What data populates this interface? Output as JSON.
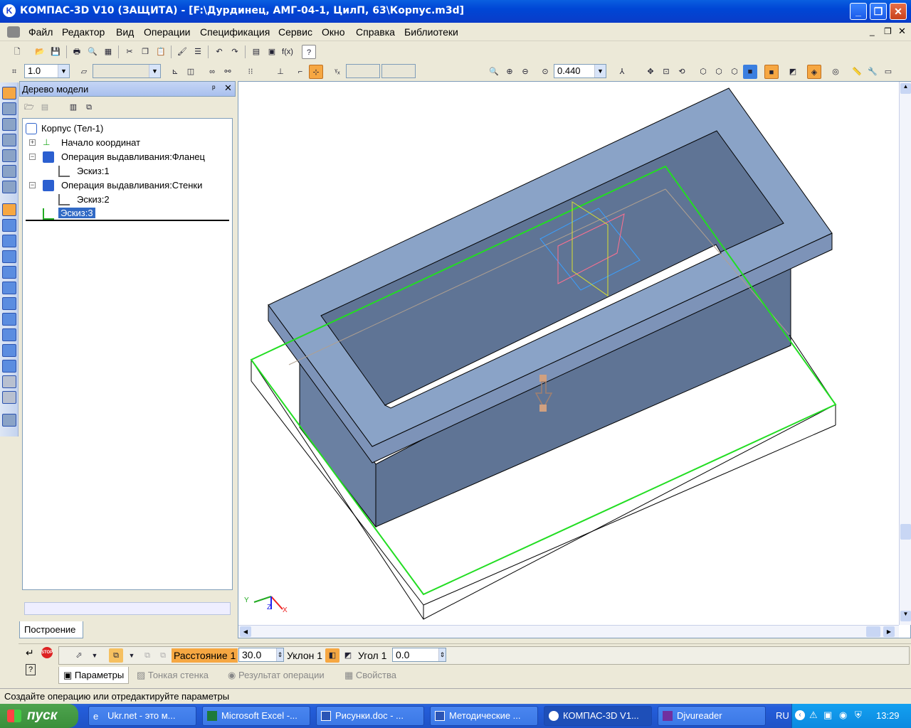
{
  "window": {
    "title": "КОМПАС-3D V10 (ЗАЩИТА) - [F:\\Дурдинец, АМГ-04-1, ЦилП, 63\\Корпус.m3d]",
    "app_icon": "K"
  },
  "menu": {
    "items": [
      "Файл",
      "Редактор",
      "Вид",
      "Операции",
      "Спецификация",
      "Сервис",
      "Окно",
      "Справка",
      "Библиотеки"
    ]
  },
  "toolbar2": {
    "step_value": "1.0",
    "zoom_value": "0.440"
  },
  "tree": {
    "header": "Дерево модели",
    "items": [
      {
        "label": "Корпус (Тел-1)"
      },
      {
        "label": "Начало координат"
      },
      {
        "label": "Операция выдавливания:Фланец"
      },
      {
        "label": "Эскиз:1"
      },
      {
        "label": "Операция выдавливания:Стенки"
      },
      {
        "label": "Эскиз:2"
      },
      {
        "label": "Эскиз:3"
      }
    ],
    "bottom_tab": "Построение"
  },
  "viewport": {
    "axes": {
      "x": "X",
      "y": "Y",
      "z": "Z"
    },
    "body_color": "#5f7495",
    "top_color": "#8aa3c7",
    "sketch_color": "#22dd22"
  },
  "properties": {
    "distance_label": "Расстояние 1",
    "distance_value": "30.0",
    "slope_label": "Уклон 1",
    "angle_label": "Угол 1",
    "angle_value": "0.0",
    "tabs": [
      "Параметры",
      "Тонкая стенка",
      "Результат операции",
      "Свойства"
    ],
    "stop_label": "STOP"
  },
  "status": {
    "text": "Создайте операцию или отредактируйте параметры"
  },
  "taskbar": {
    "start_label": "пуск",
    "tasks": [
      {
        "label": "Ukr.net - это м..."
      },
      {
        "label": "Microsoft Excel -..."
      },
      {
        "label": "Рисунки.doc - ..."
      },
      {
        "label": "Методические ..."
      },
      {
        "label": "КОМПАС-3D V1..."
      },
      {
        "label": "Djvureader"
      }
    ],
    "lang": "RU",
    "clock": "13:29"
  }
}
